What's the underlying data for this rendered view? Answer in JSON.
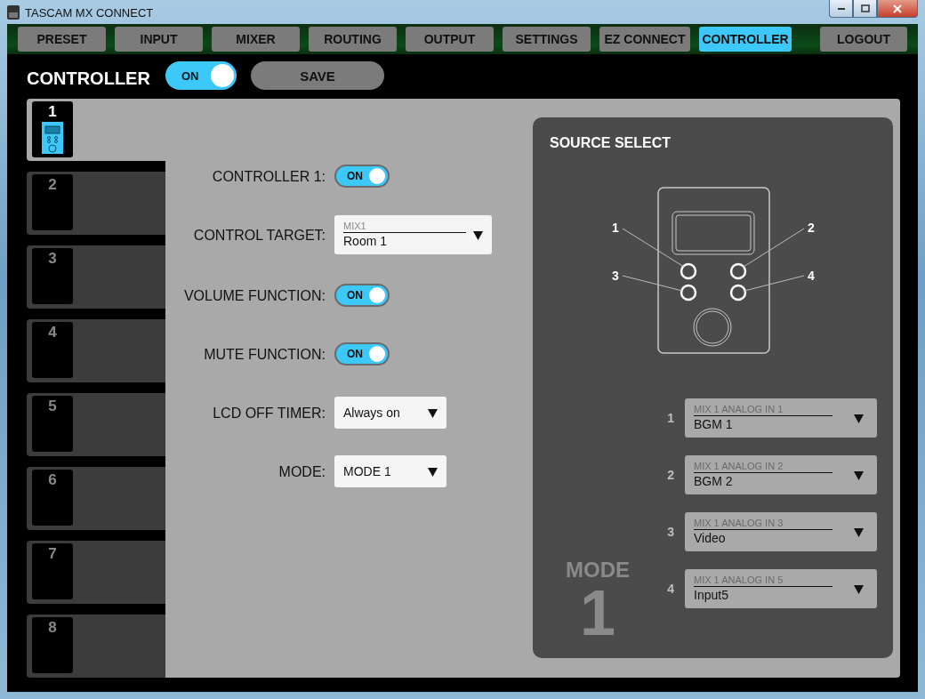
{
  "window": {
    "title": "TASCAM MX CONNECT"
  },
  "tabs": [
    {
      "label": "PRESET",
      "selected": false
    },
    {
      "label": "INPUT",
      "selected": false
    },
    {
      "label": "MIXER",
      "selected": false
    },
    {
      "label": "ROUTING",
      "selected": false
    },
    {
      "label": "OUTPUT",
      "selected": false
    },
    {
      "label": "SETTINGS",
      "selected": false
    },
    {
      "label": "EZ CONNECT",
      "selected": false
    },
    {
      "label": "CONTROLLER",
      "selected": true
    }
  ],
  "logout": "LOGOUT",
  "header": {
    "title": "CONTROLLER",
    "toggle": {
      "label": "ON",
      "on": true
    },
    "save": "SAVE"
  },
  "controllers": [
    {
      "number": "1",
      "selected": true,
      "connected": true
    },
    {
      "number": "2",
      "selected": false,
      "connected": false
    },
    {
      "number": "3",
      "selected": false,
      "connected": false
    },
    {
      "number": "4",
      "selected": false,
      "connected": false
    },
    {
      "number": "5",
      "selected": false,
      "connected": false
    },
    {
      "number": "6",
      "selected": false,
      "connected": false
    },
    {
      "number": "7",
      "selected": false,
      "connected": false
    },
    {
      "number": "8",
      "selected": false,
      "connected": false
    }
  ],
  "settings": [
    {
      "kind": "toggle",
      "label": "CONTROLLER 1:",
      "value": "ON",
      "on": true
    },
    {
      "kind": "select",
      "label": "CONTROL TARGET:",
      "caption": "MIX1",
      "value": "Room 1"
    },
    {
      "kind": "toggle",
      "label": "VOLUME FUNCTION:",
      "value": "ON",
      "on": true
    },
    {
      "kind": "toggle",
      "label": "MUTE FUNCTION:",
      "value": "ON",
      "on": true
    },
    {
      "kind": "dropdown",
      "label": "LCD OFF TIMER:",
      "value": "Always on"
    },
    {
      "kind": "dropdown",
      "label": "MODE:",
      "value": "MODE 1"
    }
  ],
  "source_select": {
    "title": "SOURCE SELECT",
    "callouts": [
      "1",
      "2",
      "3",
      "4"
    ],
    "mode_label": "MODE",
    "mode_number": "1",
    "sources": [
      {
        "number": "1",
        "caption": "MIX 1 ANALOG IN 1",
        "value": "BGM 1"
      },
      {
        "number": "2",
        "caption": "MIX 1 ANALOG IN 2",
        "value": "BGM 2"
      },
      {
        "number": "3",
        "caption": "MIX 1 ANALOG IN 3",
        "value": "Video"
      },
      {
        "number": "4",
        "caption": "MIX 1 ANALOG IN 5",
        "value": "Input5"
      }
    ]
  }
}
